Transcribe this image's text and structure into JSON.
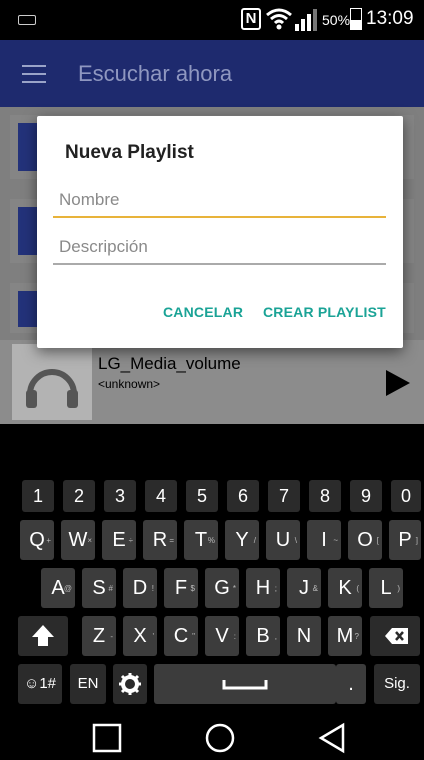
{
  "status": {
    "battery": "50%",
    "time": "13:09"
  },
  "appbar": {
    "title": "Escuchar ahora"
  },
  "dialog": {
    "title": "Nueva Playlist",
    "name_placeholder": "Nombre",
    "name_value": "",
    "desc_placeholder": "Descripción",
    "desc_value": "",
    "cancel_label": "CANCELAR",
    "create_label": "CREAR PLAYLIST"
  },
  "player": {
    "track": "LG_Media_volume",
    "artist": "<unknown>"
  },
  "keyboard": {
    "row0": [
      "1",
      "2",
      "3",
      "4",
      "5",
      "6",
      "7",
      "8",
      "9",
      "0"
    ],
    "row1": [
      "Q",
      "W",
      "E",
      "R",
      "T",
      "Y",
      "U",
      "I",
      "O",
      "P"
    ],
    "row1_hints": [
      "+",
      "×",
      "÷",
      "=",
      "%",
      "/",
      "\\",
      "~",
      "[",
      "]"
    ],
    "row2": [
      "A",
      "S",
      "D",
      "F",
      "G",
      "H",
      "J",
      "K",
      "L"
    ],
    "row2_hints": [
      "@",
      "#",
      "!",
      "$",
      "*",
      ";",
      "&",
      "(",
      ")"
    ],
    "row3": [
      "Z",
      "X",
      "C",
      "V",
      "B",
      "N",
      "M"
    ],
    "row3_hints": [
      "-",
      "'",
      "\"",
      ":",
      ",",
      "",
      "?"
    ],
    "symbols_label": "☺1#",
    "lang_label": "EN",
    "period_label": ".",
    "go_label": "Sig."
  },
  "colors": {
    "accent": "#1aa396",
    "focus": "#e8b33a",
    "appbar": "#1e2a6e"
  },
  "icons": [
    "menu-icon",
    "nfc-icon",
    "wifi-icon",
    "signal-icon",
    "battery-icon",
    "play-icon",
    "headphones-icon",
    "shift-icon",
    "backspace-icon",
    "settings-icon",
    "space-icon",
    "back-icon",
    "home-icon",
    "recents-icon"
  ]
}
